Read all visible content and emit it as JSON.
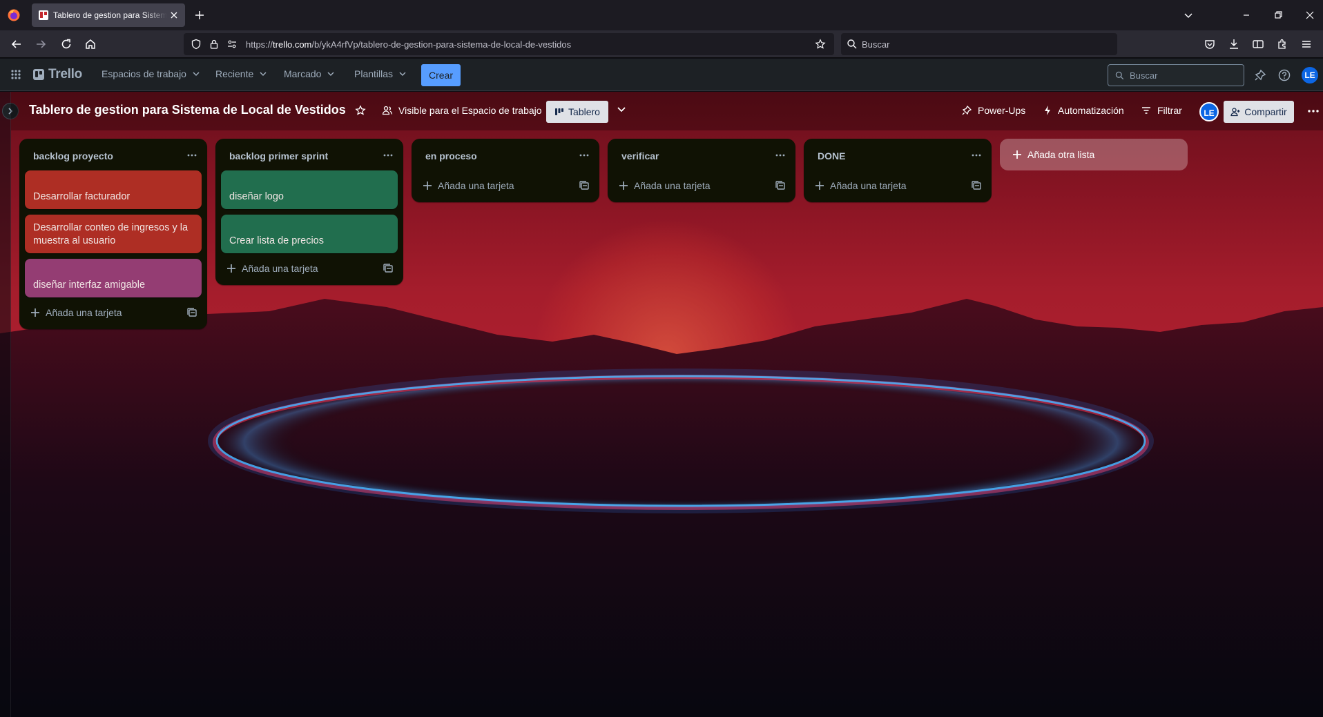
{
  "browser": {
    "tab_title": "Tablero de gestion para Sistema de Local de Vestidos",
    "url_prefix": "https://",
    "url_domain": "trello.com",
    "url_path": "/b/ykA4rfVp/tablero-de-gestion-para-sistema-de-local-de-vestidos",
    "search_placeholder": "Buscar"
  },
  "trello_header": {
    "logo": "Trello",
    "menus": [
      "Espacios de trabajo",
      "Reciente",
      "Marcado",
      "Plantillas"
    ],
    "create_label": "Crear",
    "search_placeholder": "Buscar",
    "avatar_initials": "LE"
  },
  "board": {
    "title": "Tablero de gestion para Sistema de Local de Vestidos",
    "visibility_label": "Visible para el Espacio de trabajo",
    "view_label": "Tablero",
    "powerups_label": "Power-Ups",
    "automation_label": "Automatización",
    "filter_label": "Filtrar",
    "avatar_initials": "LE",
    "share_label": "Compartir",
    "add_card_label": "Añada una tarjeta",
    "add_list_label": "Añada otra lista",
    "lists": [
      {
        "title": "backlog proyecto",
        "cards": [
          {
            "text": "Desarrollar facturador",
            "color": "red"
          },
          {
            "text": "Desarrollar conteo de ingresos y la muestra al usuario",
            "color": "red"
          },
          {
            "text": "diseñar interfaz amigable",
            "color": "magenta"
          }
        ]
      },
      {
        "title": "backlog primer sprint",
        "cards": [
          {
            "text": "diseñar logo",
            "color": "green"
          },
          {
            "text": "Crear lista de precios",
            "color": "green"
          }
        ]
      },
      {
        "title": "en proceso",
        "cards": []
      },
      {
        "title": "verificar",
        "cards": []
      },
      {
        "title": "DONE",
        "cards": []
      }
    ]
  },
  "colors": {
    "card_red": "#ae2e24",
    "card_green": "#216e4e",
    "card_magenta": "#943d73",
    "create_button": "#579dff",
    "list_bg": "#101204"
  }
}
